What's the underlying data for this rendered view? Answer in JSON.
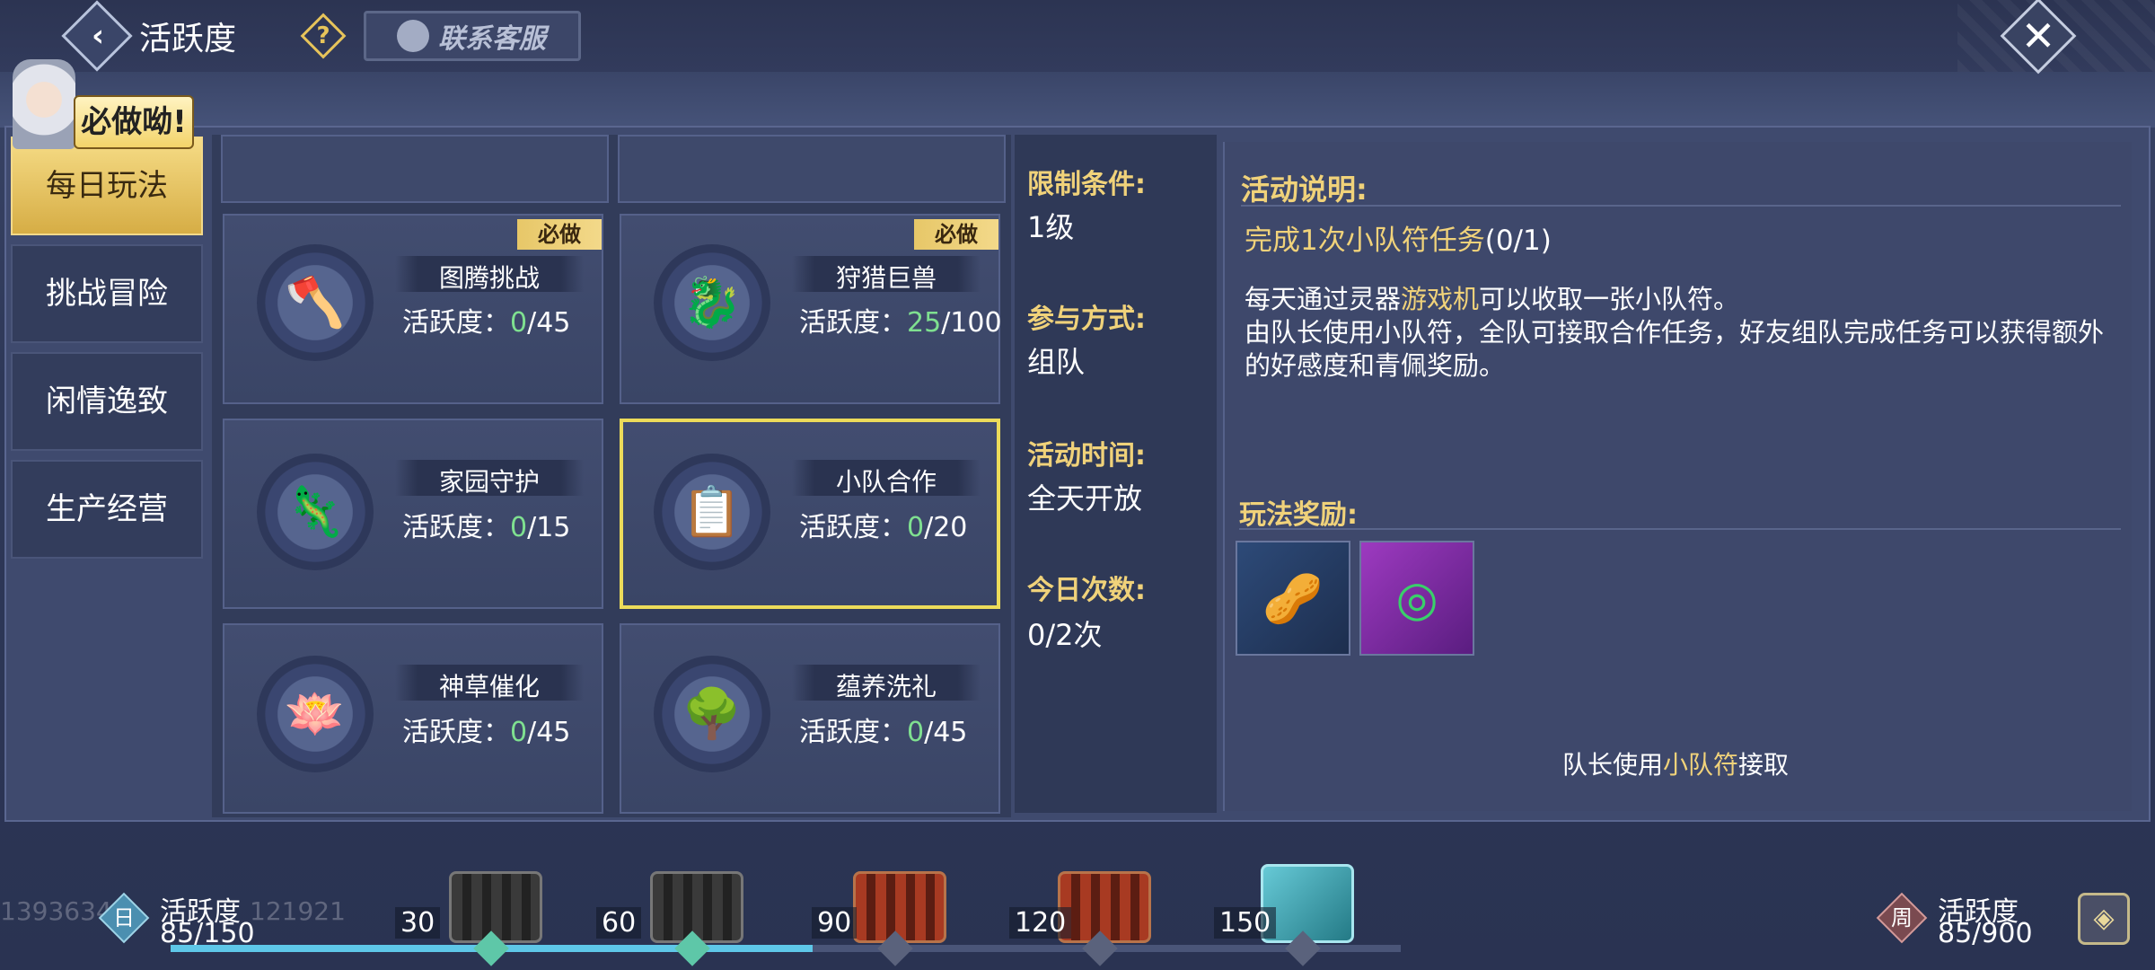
{
  "header": {
    "title": "活跃度",
    "service_label": "联系客服"
  },
  "sidebar": {
    "bubble": "必做呦!",
    "items": [
      {
        "label": "每日玩法",
        "active": true
      },
      {
        "label": "挑战冒险",
        "active": false
      },
      {
        "label": "闲情逸致",
        "active": false
      },
      {
        "label": "生产经营",
        "active": false
      }
    ]
  },
  "activities": [
    {
      "name": "图腾挑战",
      "prefix": "活跃度：",
      "current": "0",
      "max": "/45",
      "must": "必做",
      "icon": "axe-icon"
    },
    {
      "name": "狩猎巨兽",
      "prefix": "活跃度：",
      "current": "25",
      "max": "/100",
      "must": "必做",
      "icon": "beast-icon"
    },
    {
      "name": "家园守护",
      "prefix": "活跃度：",
      "current": "0",
      "max": "/15",
      "must": "",
      "icon": "dragon-icon"
    },
    {
      "name": "小队合作",
      "prefix": "活跃度：",
      "current": "0",
      "max": "/20",
      "must": "",
      "icon": "notepad-icon",
      "selected": true
    },
    {
      "name": "神草催化",
      "prefix": "活跃度：",
      "current": "0",
      "max": "/45",
      "must": "",
      "icon": "flower-icon"
    },
    {
      "name": "蕴养洗礼",
      "prefix": "活跃度：",
      "current": "0",
      "max": "/45",
      "must": "",
      "icon": "tree-icon"
    }
  ],
  "info": {
    "limit_label": "限制条件:",
    "limit_value": "1级",
    "mode_label": "参与方式:",
    "mode_value": "组队",
    "time_label": "活动时间:",
    "time_value": "全天开放",
    "count_label": "今日次数:",
    "count_value": "0/2次"
  },
  "description": {
    "title": "活动说明:",
    "task": "完成1次小队符任务",
    "task_count": "(0/1)",
    "line1_a": "每天通过灵器",
    "line1_hl": "游戏机",
    "line1_b": "可以收取一张小队符。",
    "line2": "由队长使用小队符，全队可接取合作任务，好友组队完成任务可以获得额外的好感度和青佩奖励。",
    "reward_title": "玩法奖励:",
    "rewards": [
      "seed-icon",
      "jade-icon"
    ],
    "captain_a": "队长使用",
    "captain_hl": "小队符",
    "captain_b": "接取"
  },
  "bottom": {
    "daily_icon_text": "日",
    "daily_label": "活跃度",
    "daily_value": "85/150",
    "daily_progress": 85,
    "daily_max": 150,
    "milestones": [
      "30",
      "60",
      "90",
      "120",
      "150"
    ],
    "weekly_icon_text": "周",
    "weekly_label": "活跃度",
    "weekly_value": "85/900",
    "watermark_left": "1393634",
    "watermark_right": "121921"
  },
  "colors": {
    "gold": "#f0d27a",
    "green": "#7fe090",
    "select": "#ecdb5a",
    "progress": "#5ec7e8"
  }
}
